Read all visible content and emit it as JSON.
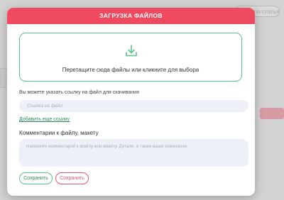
{
  "background": {
    "search_placeholder": "...иск по статьям"
  },
  "modal": {
    "title": "ЗАГРУЗКА ФАЙЛОВ",
    "header_color": "#ef4a60",
    "accent_color": "#59c489",
    "dropzone": {
      "icon": "download-tray-icon",
      "text": "Перетащите сюда файлы или кликните для выбора"
    },
    "link_section": {
      "label": "Вы можете указать ссылку на файл для скачивания",
      "input_placeholder": "Ссылка на файл",
      "add_link": "Добавить еще ссылку"
    },
    "comment_section": {
      "label": "Комментарии к файлу, макету",
      "placeholder": "Напишите комментарий к файлу или макету. Детали, а также ваши пожелания"
    },
    "buttons": {
      "save_primary": "Сохранить",
      "save_secondary": "Сохранить"
    }
  }
}
